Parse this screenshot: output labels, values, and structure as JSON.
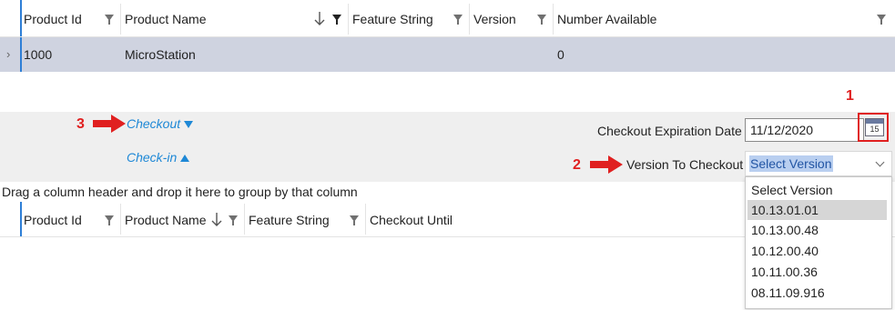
{
  "top_grid": {
    "columns": [
      {
        "label": "Product Id"
      },
      {
        "label": "Product Name"
      },
      {
        "label": "Feature String"
      },
      {
        "label": "Version"
      },
      {
        "label": "Number Available"
      }
    ],
    "row": {
      "expander": "›",
      "product_id": "1000",
      "product_name": "MicroStation",
      "feature_string": "",
      "version": "",
      "number_available": "0"
    }
  },
  "checkout_panel": {
    "checkout_link": "Checkout",
    "checkin_link": "Check-in",
    "expiration_label": "Checkout Expiration Date",
    "expiration_value": "11/12/2020",
    "calendar_day": "15",
    "version_label": "Version To Checkout",
    "version_selected": "Select Version"
  },
  "annotations": {
    "a1": "1",
    "a2": "2",
    "a3": "3"
  },
  "group_bar_text": "Drag a column header and drop it here to group by that column",
  "bottom_grid": {
    "columns": [
      {
        "label": "Product Id"
      },
      {
        "label": "Product Name"
      },
      {
        "label": "Feature String"
      },
      {
        "label": "Checkout Until"
      }
    ]
  },
  "version_dropdown": {
    "options": [
      "Select Version",
      "10.13.01.01",
      "10.13.00.48",
      "10.12.00.40",
      "10.11.00.36",
      "08.11.09.916"
    ],
    "highlighted_index": 1
  },
  "colors": {
    "accent": "#1e88d6",
    "annotation": "#e02020",
    "selected_row": "#cfd3e0"
  }
}
